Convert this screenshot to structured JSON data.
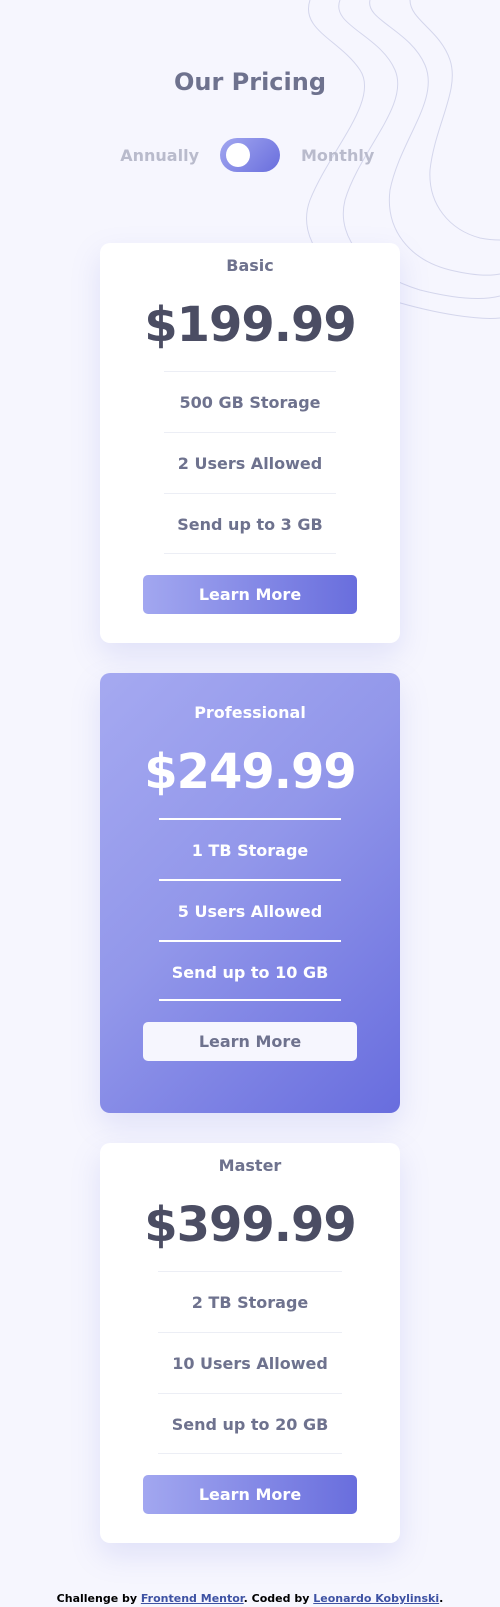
{
  "page": {
    "title": "Our Pricing"
  },
  "billing_toggle": {
    "left_label": "Annually",
    "right_label": "Monthly",
    "state": "annually"
  },
  "plans": [
    {
      "name": "Basic",
      "price": "$199.99",
      "features": [
        "500 GB Storage",
        "2 Users Allowed",
        "Send up to 3 GB"
      ],
      "button_label": "Learn More"
    },
    {
      "name": "Professional",
      "price": "$249.99",
      "features": [
        "1 TB Storage",
        "5 Users Allowed",
        "Send up to 10 GB"
      ],
      "button_label": "Learn More"
    },
    {
      "name": "Master",
      "price": "$399.99",
      "features": [
        "2 TB Storage",
        "10 Users Allowed",
        "Send up to 20 GB"
      ],
      "button_label": "Learn More"
    }
  ],
  "attribution": {
    "prefix": "Challenge by ",
    "link1": "Frontend Mentor",
    "middle": ". Coded by ",
    "link2": "Leonardo Kobylinski",
    "suffix": "."
  },
  "colors": {
    "background": "#f6f6fe",
    "accent_start": "#a2a7f0",
    "accent_end": "#696edd",
    "text": "#6e728e",
    "price_text": "#4b4d63"
  }
}
